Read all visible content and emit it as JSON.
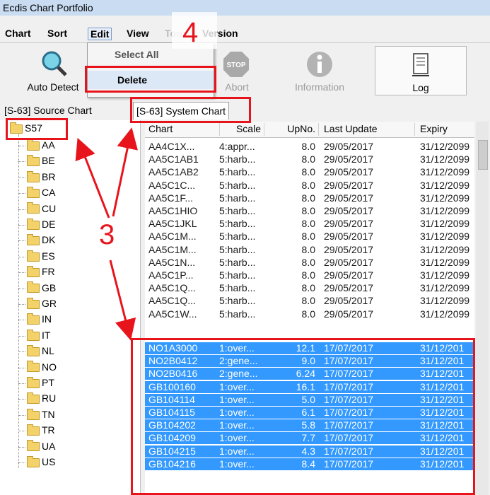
{
  "window": {
    "title": "Ecdis Chart Portfolio"
  },
  "menu": {
    "chart": "Chart",
    "sort": "Sort",
    "edit": "Edit",
    "view": "View",
    "tools": "Too",
    "version": "Version"
  },
  "edit_menu": {
    "select_all": "Select All",
    "delete": "Delete"
  },
  "toolbar": {
    "auto_detect": "Auto Detect",
    "abort": "Abort",
    "information": "Information",
    "log": "Log",
    "stop_text": "STOP"
  },
  "tabs": {
    "source": "[S-63] Source Chart",
    "system": "[S-63] System Chart"
  },
  "tree": {
    "root": "S57",
    "children": [
      "AA",
      "BE",
      "BR",
      "CA",
      "CU",
      "DE",
      "DK",
      "ES",
      "FR",
      "GB",
      "GR",
      "IN",
      "IT",
      "NL",
      "NO",
      "PT",
      "RU",
      "TN",
      "TR",
      "UA",
      "US"
    ]
  },
  "table": {
    "headers": [
      "Chart",
      "Scale",
      "UpNo.",
      "Last Update",
      "Expiry"
    ],
    "rows": [
      [
        "AA4C1X...",
        "4:appr...",
        "8.0",
        "29/05/2017",
        "31/12/2099"
      ],
      [
        "AA5C1AB1",
        "5:harb...",
        "8.0",
        "29/05/2017",
        "31/12/2099"
      ],
      [
        "AA5C1AB2",
        "5:harb...",
        "8.0",
        "29/05/2017",
        "31/12/2099"
      ],
      [
        "AA5C1C...",
        "5:harb...",
        "8.0",
        "29/05/2017",
        "31/12/2099"
      ],
      [
        "AA5C1F...",
        "5:harb...",
        "8.0",
        "29/05/2017",
        "31/12/2099"
      ],
      [
        "AA5C1HIO",
        "5:harb...",
        "8.0",
        "29/05/2017",
        "31/12/2099"
      ],
      [
        "AA5C1JKL",
        "5:harb...",
        "8.0",
        "29/05/2017",
        "31/12/2099"
      ],
      [
        "AA5C1M...",
        "5:harb...",
        "8.0",
        "29/05/2017",
        "31/12/2099"
      ],
      [
        "AA5C1M...",
        "5:harb...",
        "8.0",
        "29/05/2017",
        "31/12/2099"
      ],
      [
        "AA5C1N...",
        "5:harb...",
        "8.0",
        "29/05/2017",
        "31/12/2099"
      ],
      [
        "AA5C1P...",
        "5:harb...",
        "8.0",
        "29/05/2017",
        "31/12/2099"
      ],
      [
        "AA5C1Q...",
        "5:harb...",
        "8.0",
        "29/05/2017",
        "31/12/2099"
      ],
      [
        "AA5C1Q...",
        "5:harb...",
        "8.0",
        "29/05/2017",
        "31/12/2099"
      ],
      [
        "AA5C1W...",
        "5:harb...",
        "8.0",
        "29/05/2017",
        "31/12/2099"
      ]
    ],
    "selected_rows": [
      [
        "NO1A3000",
        "1:over...",
        "12.1",
        "17/07/2017",
        "31/12/201"
      ],
      [
        "NO2B0412",
        "2:gene...",
        "9.0",
        "17/07/2017",
        "31/12/201"
      ],
      [
        "NO2B0416",
        "2:gene...",
        "6.24",
        "17/07/2017",
        "31/12/201"
      ],
      [
        "GB100160",
        "1:over...",
        "16.1",
        "17/07/2017",
        "31/12/201"
      ],
      [
        "GB104114",
        "1:over...",
        "5.0",
        "17/07/2017",
        "31/12/201"
      ],
      [
        "GB104115",
        "1:over...",
        "6.1",
        "17/07/2017",
        "31/12/201"
      ],
      [
        "GB104202",
        "1:over...",
        "5.8",
        "17/07/2017",
        "31/12/201"
      ],
      [
        "GB104209",
        "1:over...",
        "7.7",
        "17/07/2017",
        "31/12/201"
      ],
      [
        "GB104215",
        "1:over...",
        "4.3",
        "17/07/2017",
        "31/12/201"
      ],
      [
        "GB104216",
        "1:over...",
        "8.4",
        "17/07/2017",
        "31/12/201"
      ]
    ]
  },
  "annotations": {
    "step3": "3",
    "step4": "4",
    "color": "#e8141c"
  },
  "colors": {
    "selection": "#3399ff",
    "titlebar": "#c9dcf2"
  }
}
